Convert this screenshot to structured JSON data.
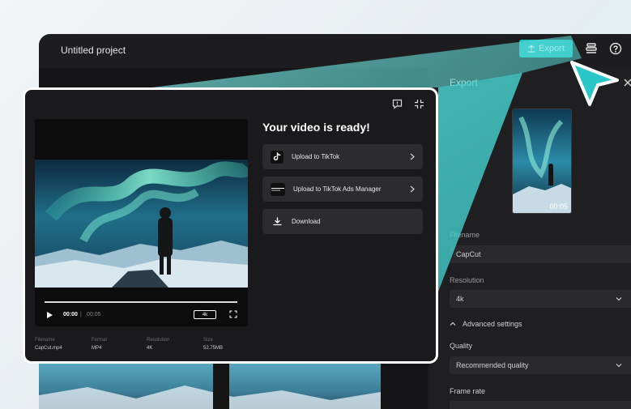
{
  "app": {
    "project_title": "Untitled project",
    "export_button": "Export",
    "colors": {
      "accent": "#22c4c7",
      "panel": "#1f1f22",
      "modal": "#1a1a1c"
    }
  },
  "export_panel": {
    "title": "Export",
    "thumbnail_duration": "00:05",
    "filename_label": "Filename",
    "filename_value": "CapCut",
    "resolution_label": "Resolution",
    "resolution_value": "4k",
    "advanced_settings": "Advanced settings",
    "quality_label": "Quality",
    "quality_value": "Recommended quality",
    "frame_rate_label": "Frame rate"
  },
  "modal": {
    "title": "Your video is ready!",
    "actions": [
      {
        "label": "Upload to TikTok",
        "icon": "tiktok-icon"
      },
      {
        "label": "Upload to TikTok Ads Manager",
        "icon": "tiktok-ads-icon"
      },
      {
        "label": "Download",
        "icon": "download-icon"
      }
    ],
    "player": {
      "current_time": "00:00",
      "separator": "|",
      "total_time": "00:05",
      "quality_badge": "4k"
    },
    "meta": [
      {
        "key": "Filename",
        "value": "CapCut.mp4"
      },
      {
        "key": "Format",
        "value": "MP4"
      },
      {
        "key": "Resolution",
        "value": "4K"
      },
      {
        "key": "Size",
        "value": "52.75MB"
      }
    ]
  }
}
